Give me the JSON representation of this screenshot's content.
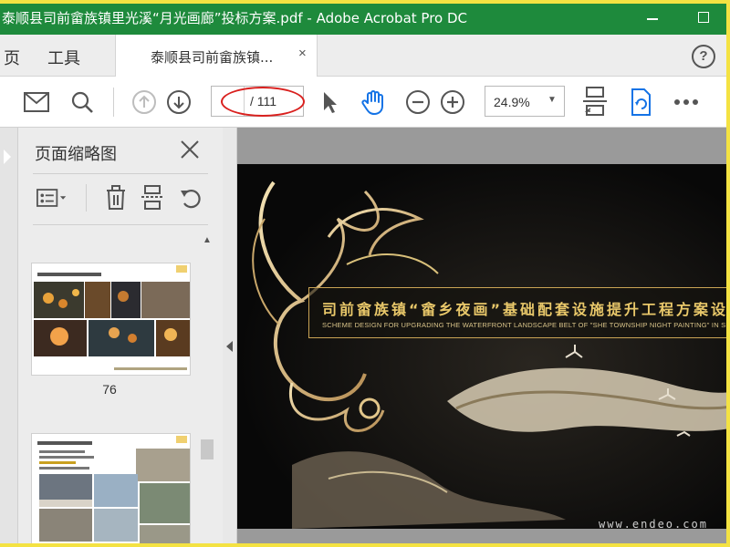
{
  "window": {
    "title": "泰顺县司前畲族镇里光溪“月光画廊”投标方案.pdf - Adobe Acrobat Pro DC"
  },
  "menu": {
    "home_label": "页",
    "tools_label": "工具"
  },
  "tab": {
    "label": "泰顺县司前畲族镇...",
    "close_label": "×"
  },
  "help_label": "?",
  "toolbar": {
    "page_current": "",
    "page_total": "/ 111",
    "zoom_value": "24.9%",
    "icons": [
      "mail-icon",
      "search-icon",
      "arrow-up-icon",
      "arrow-down-icon",
      "select-pointer-icon",
      "hand-icon",
      "zoom-out-icon",
      "zoom-in-icon",
      "fit-page-icon",
      "rotate-view-icon",
      "more-icon"
    ]
  },
  "sidebar": {
    "title": "页面缩略图",
    "close_label": "✕",
    "page_number": "76"
  },
  "document": {
    "banner_title": "司前畲族镇“畲乡夜画”基础配套设施提升工程方案设计",
    "banner_subtitle": "SCHEME DESIGN FOR UPGRADING THE WATERFRONT LANDSCAPE BELT OF \"SHE TOWNSHIP NIGHT PAINTING\" IN SIQIAN SHE ETHNIC",
    "watermark": "www.endeo.com"
  },
  "colors": {
    "titlebar": "#1e8a3c",
    "annotation_ellipse": "#d9201e",
    "accent_blue": "#1473e6"
  }
}
